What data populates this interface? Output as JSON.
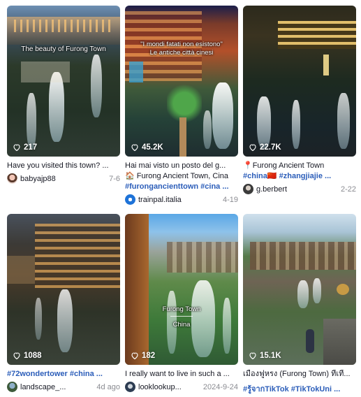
{
  "cards": [
    {
      "likes": "217",
      "overlay": "The beauty of Furong Town",
      "desc": "Have you visited this town? ...",
      "user": "babyajp88",
      "date": "7-6"
    },
    {
      "likes": "45.2K",
      "overlay1": "\"I mondi fatati non esistono\"",
      "overlay2": "Le antiche città cinesi",
      "desc1": "Hai mai visto un posto del g...",
      "desc2": "🏠 Furong Ancient Town, Cina",
      "desc3": "#furongancienttown #cina ...",
      "user": "trainpal.italia",
      "date": "4-19"
    },
    {
      "likes": "22.7K",
      "desc1": "📍Furong Ancient Town",
      "desc2_tag1": "#china",
      "desc2_flag": "🇨🇳",
      "desc2_tag2": "#zhangjiajie ...",
      "user": "g.berbert",
      "date": "2-22"
    },
    {
      "likes": "1088",
      "desc": "#72wondertower #china ...",
      "user": "landscape_...",
      "date": "4d ago"
    },
    {
      "likes": "182",
      "overlay1": "Furong Town",
      "overlay2": "China",
      "desc": "I really want to live in such a ...",
      "user": "looklookup...",
      "date": "2024-9-24"
    },
    {
      "likes": "15.1K",
      "desc1": "เมืองฟูหรง (Furong Town) ที่เที่...",
      "desc2": "#รู้จากTikTok #TikTokUni ..."
    }
  ],
  "icons": {
    "likes": "heart-outline-icon"
  }
}
